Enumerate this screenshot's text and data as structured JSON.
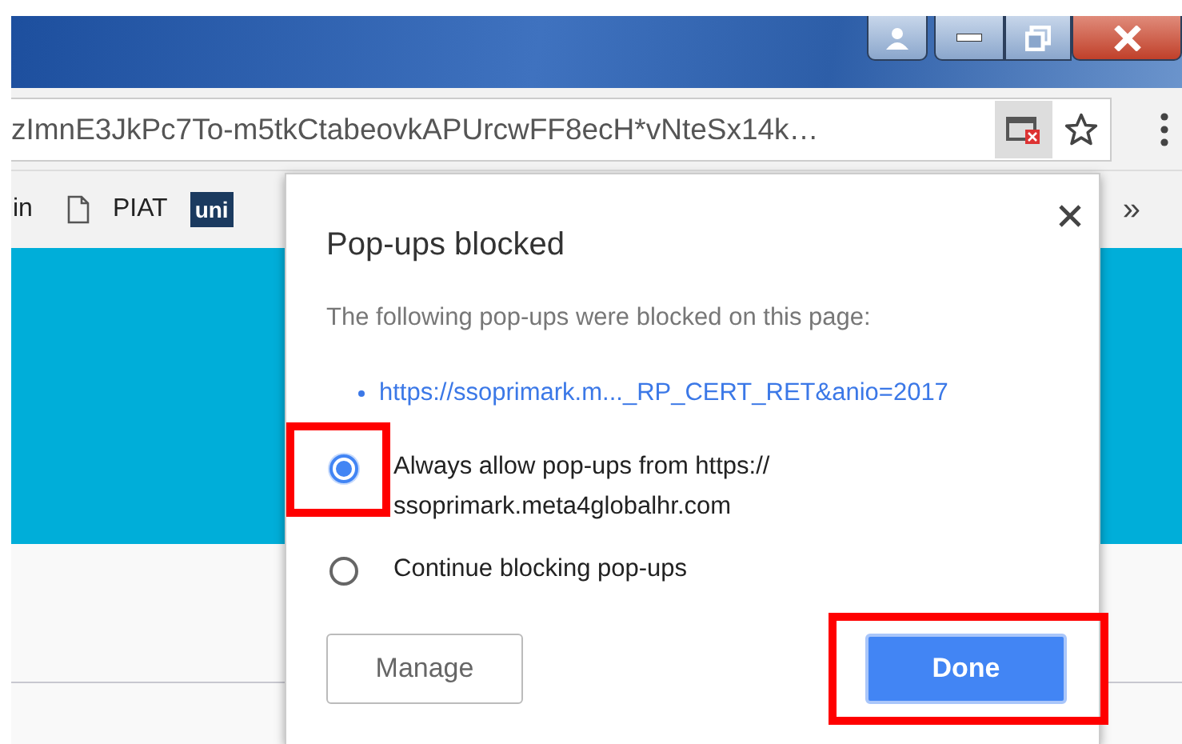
{
  "address_bar": {
    "url": "zImnE3JkPc7To-m5tkCtabeovkAPUrcwFF8ecH*vNteSx14k…"
  },
  "bookmarks": [
    {
      "label": "in",
      "kind": "text"
    },
    {
      "label": "PIAT",
      "kind": "page"
    },
    {
      "label": "uni",
      "kind": "logo"
    }
  ],
  "bookmarks_overflow": "»",
  "popup": {
    "title": "Pop-ups blocked",
    "message": "The following pop-ups were blocked on this page:",
    "blocked_links": [
      "https://ssoprimark.m..._RP_CERT_RET&anio=2017"
    ],
    "options": [
      {
        "label": "Always allow pop-ups from https:// ssoprimark.meta4globalhr.com",
        "selected": true,
        "highlighted": true
      },
      {
        "label": "Continue blocking pop-ups",
        "selected": false,
        "highlighted": false
      }
    ],
    "buttons": [
      {
        "label": "Manage",
        "kind": "secondary",
        "highlighted": false
      },
      {
        "label": "Done",
        "kind": "primary",
        "highlighted": true
      }
    ]
  }
}
